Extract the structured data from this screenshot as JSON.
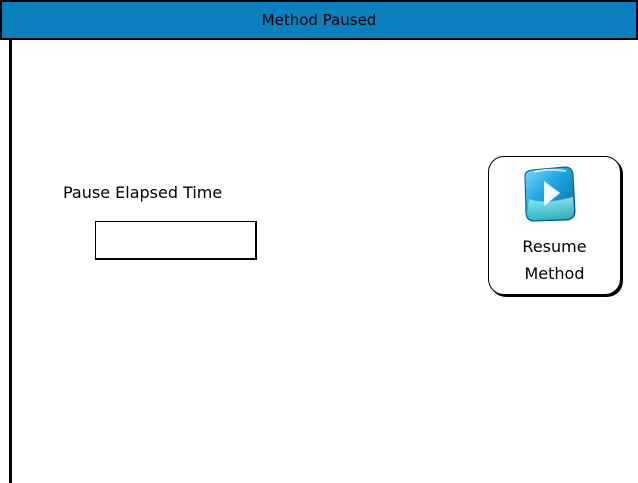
{
  "window": {
    "title": "Method Paused"
  },
  "pause": {
    "label": "Pause Elapsed Time",
    "elapsed_value": ""
  },
  "resume_button": {
    "line1": "Resume",
    "line2": "Method",
    "icon": "play-icon"
  },
  "colors": {
    "title_bar": "#0a7fbe",
    "icon_blue": "#1aa3dd",
    "icon_teal": "#39c6c0"
  }
}
